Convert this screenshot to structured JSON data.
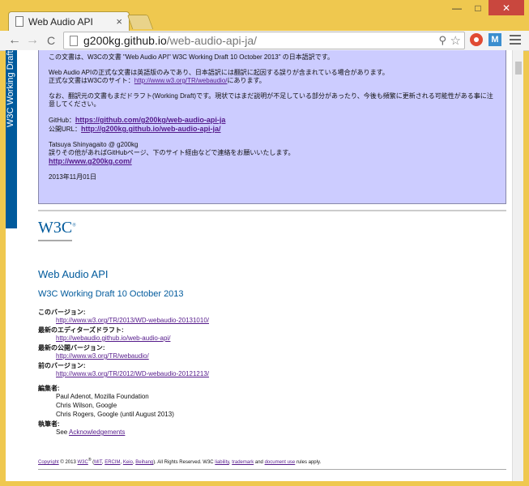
{
  "browser": {
    "tab_title": "Web Audio API",
    "tab_close": "×",
    "url_host": "g200kg.github.io",
    "url_path": "/web-audio-api-ja/",
    "zoom_glyph": "⚲",
    "star_glyph": "☆",
    "ext2_label": "M",
    "back_glyph": "←",
    "forward_glyph": "→",
    "reload_glyph": "C",
    "win_min": "—",
    "win_max": "□",
    "win_close": "✕"
  },
  "ribbon": {
    "label": "W3C Working Draft"
  },
  "notice": {
    "p1": "この文書は、W3Cの文書 \"Web Audio API\" W3C Working Draft 10 October 2013\" の日本語訳です。",
    "p2a": "Web Audio APIの正式な文書は英語版のみであり、日本語訳には翻訳に起因する誤りが含まれている場合があります。",
    "p2b": "正式な文書はW3Cのサイト：",
    "p2_link": "http://www.w3.org/TR/webaudio/",
    "p2c": "にあります。",
    "p3": "なお、翻訳元の文書もまだドラフト(Working Draft)です。現状ではまだ説明が不足している部分があったり、今後も頻繁に更新される可能性がある事に注意してください。",
    "github_label": "GitHub：",
    "github_link": "https://github.com/g200kg/web-audio-api-ja",
    "public_label": "公開URL：",
    "public_link": "http://g200kg.github.io/web-audio-api-ja/",
    "author": "Tatsuya Shinyagaito @ g200kg",
    "contact": "誤りその他があればGitHubページ、下のサイト経由などで連絡をお願いいたします。",
    "site_link": "http://www.g200kg.com/",
    "date": "2013年11月01日"
  },
  "logo": {
    "text": "W3C",
    "mark": "®"
  },
  "doc": {
    "title": "Web Audio API",
    "subtitle": "W3C Working Draft 10 October 2013"
  },
  "meta": {
    "this_version_label": "このバージョン:",
    "this_version": "http://www.w3.org/TR/2013/WD-webaudio-20131010/",
    "editors_draft_label": "最新のエディターズドラフト:",
    "editors_draft": "http://webaudio.github.io/web-audio-api/",
    "latest_label": "最新の公開バージョン:",
    "latest": "http://www.w3.org/TR/webaudio/",
    "previous_label": "前のバージョン:",
    "previous": "http://www.w3.org/TR/2012/WD-webaudio-20121213/",
    "editors_label": "編集者:",
    "editors": [
      "Paul Adenot, Mozilla Foundation",
      "Chris Wilson, Google",
      "Chris Rogers, Google (until August 2013)"
    ],
    "authors_label": "執筆者:",
    "authors_see": "See ",
    "authors_link": "Acknowledgements"
  },
  "copyright": {
    "c": "Copyright",
    "year": " © 2013 ",
    "w3c": "W3C",
    "reg": "®",
    "open": " (",
    "mit": "MIT",
    "ercim": "ERCIM",
    "keio": "Keio",
    "beihang": "Beihang",
    "rights": "). All Rights Reserved. W3C ",
    "liability": "liability",
    "trademark": "trademark",
    "and": " and ",
    "docuse": "document use",
    "tail": " rules apply."
  }
}
